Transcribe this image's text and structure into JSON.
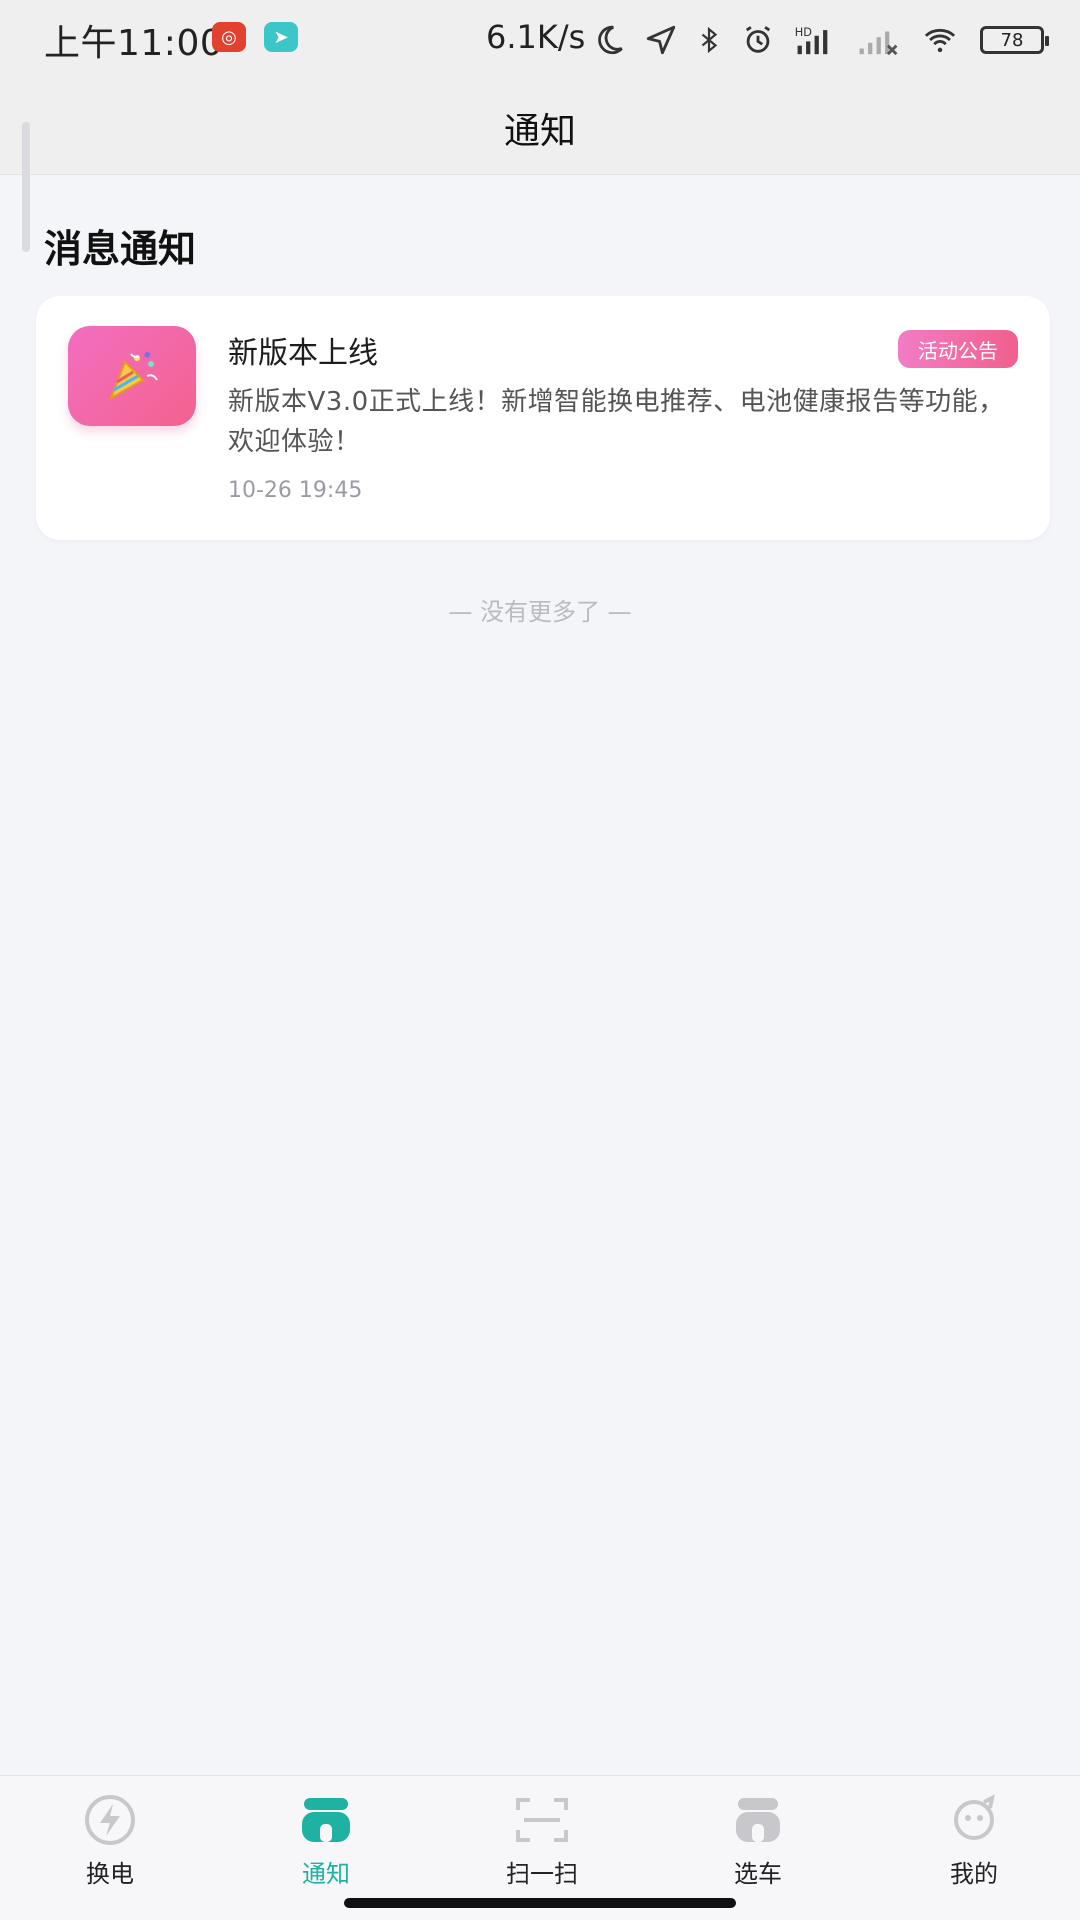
{
  "status_bar": {
    "time": "上午11:00",
    "network_speed": "6.1K/s",
    "battery_level": "78",
    "app_icons": [
      "weibo-icon",
      "paper-plane-icon"
    ]
  },
  "nav": {
    "title": "通知"
  },
  "section": {
    "title": "消息通知"
  },
  "notifications": [
    {
      "title": "新版本上线",
      "badge": "活动公告",
      "body": "新版本V3.0正式上线！新增智能换电推荐、电池健康报告等功能，欢迎体验！",
      "time": "10-26 19:45",
      "icon": "party-popper-icon"
    }
  ],
  "footer_hint": "— 没有更多了 —",
  "tabbar": {
    "items": [
      {
        "label": "换电",
        "icon": "lightning-icon",
        "active": false
      },
      {
        "label": "通知",
        "icon": "notification-icon",
        "active": true
      },
      {
        "label": "扫一扫",
        "icon": "scan-icon",
        "active": false
      },
      {
        "label": "选车",
        "icon": "scooter-icon",
        "active": false
      },
      {
        "label": "我的",
        "icon": "face-icon",
        "active": false
      }
    ]
  },
  "colors": {
    "accent": "#1fb2a3",
    "badge_start": "#f27cc5",
    "badge_end": "#f15f8d",
    "icon_start": "#f36ec1",
    "icon_end": "#f3628e",
    "inactive_icon": "#c7c7cc"
  }
}
